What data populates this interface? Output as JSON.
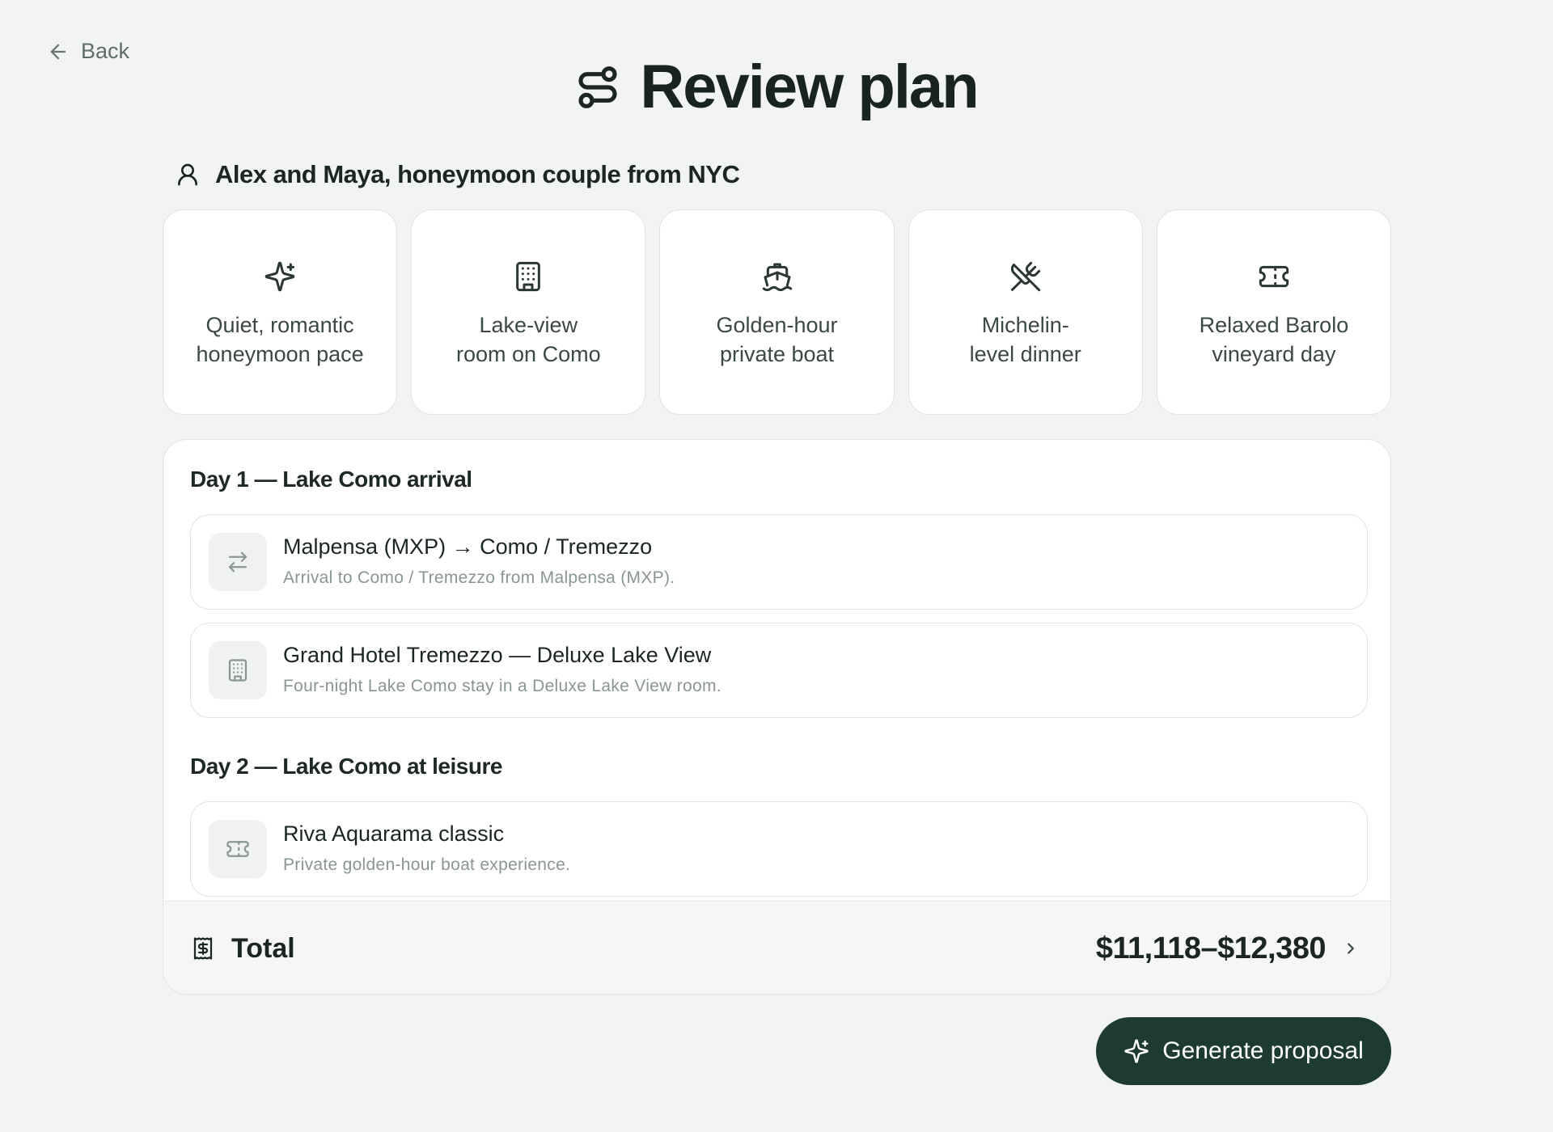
{
  "nav": {
    "back_label": "Back",
    "back_icon": "arrow-left-icon"
  },
  "header": {
    "title": "Review plan",
    "icon": "route-icon"
  },
  "client": {
    "label": "Alex and Maya, honeymoon couple from NYC",
    "icon": "user-icon"
  },
  "highlights": [
    {
      "icon": "sparkles-icon",
      "line1": "Quiet, romantic",
      "line2": "honeymoon pace"
    },
    {
      "icon": "building-icon",
      "line1": "Lake-view",
      "line2": "room on Como"
    },
    {
      "icon": "ship-icon",
      "line1": "Golden-hour",
      "line2": "private boat"
    },
    {
      "icon": "utensils-crossed-icon",
      "line1": "Michelin-",
      "line2": "level dinner"
    },
    {
      "icon": "ticket-icon",
      "line1": "Relaxed Barolo",
      "line2": "vineyard day"
    }
  ],
  "days": [
    {
      "title": "Day 1 — Lake Como arrival",
      "items": [
        {
          "icon": "transfer-icon",
          "title": "Malpensa (MXP) → Como / Tremezzo",
          "subtitle": "Arrival to Como / Tremezzo from Malpensa (MXP)."
        },
        {
          "icon": "building-icon",
          "title": "Grand Hotel Tremezzo — Deluxe Lake View",
          "subtitle": "Four-night Lake Como stay in a Deluxe Lake View room."
        }
      ]
    },
    {
      "title": "Day 2 — Lake Como at leisure",
      "items": [
        {
          "icon": "ticket-icon",
          "title": "Riva Aquarama classic",
          "subtitle": "Private golden-hour boat experience."
        }
      ]
    }
  ],
  "total": {
    "label": "Total",
    "value": "$11,118–$12,380",
    "icon": "receipt-icon"
  },
  "actions": {
    "generate_label": "Generate proposal",
    "generate_icon": "sparkles-icon"
  },
  "colors": {
    "background": "#f2f4f1",
    "primary_button": "#1d3b33",
    "text": "#1b2622",
    "muted": "#8a9691"
  }
}
